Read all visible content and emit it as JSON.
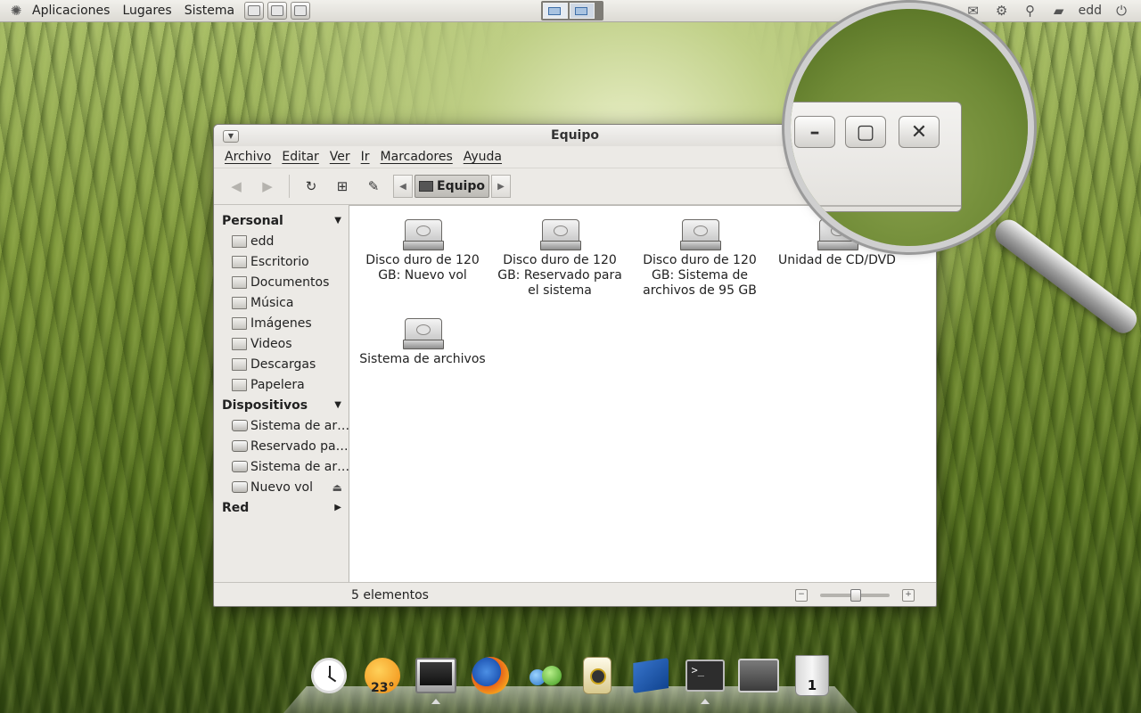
{
  "top_panel": {
    "menus": [
      "Aplicaciones",
      "Lugares",
      "Sistema"
    ],
    "user": "edd",
    "tray_icons": [
      "volume-icon",
      "mail-icon",
      "settings-icon",
      "search-icon",
      "chat-icon",
      "power-icon"
    ]
  },
  "window": {
    "title": "Equipo",
    "menubar": [
      "Archivo",
      "Editar",
      "Ver",
      "Ir",
      "Marcadores",
      "Ayuda"
    ],
    "breadcrumb": "Equipo",
    "sidebar": {
      "personal_label": "Personal",
      "personal_items": [
        "edd",
        "Escritorio",
        "Documentos",
        "Música",
        "Imágenes",
        "Videos",
        "Descargas",
        "Papelera"
      ],
      "devices_label": "Dispositivos",
      "device_items": [
        "Sistema de ar…",
        "Reservado pa…",
        "Sistema de ar…",
        "Nuevo vol"
      ],
      "network_label": "Red"
    },
    "files": [
      {
        "name": "Disco duro de 120 GB: Nuevo vol"
      },
      {
        "name": "Disco duro de 120 GB: Reservado para el sistema"
      },
      {
        "name": "Disco duro de 120 GB: Sistema de archivos de 95 GB"
      },
      {
        "name": "Unidad de CD/DVD"
      },
      {
        "name": "Sistema de archivos"
      }
    ],
    "status": "5 elementos",
    "zoom_level": 0.5
  },
  "dock": {
    "weather_temp": "23°",
    "trash_count": "1",
    "terminal_prompt": ">_"
  }
}
